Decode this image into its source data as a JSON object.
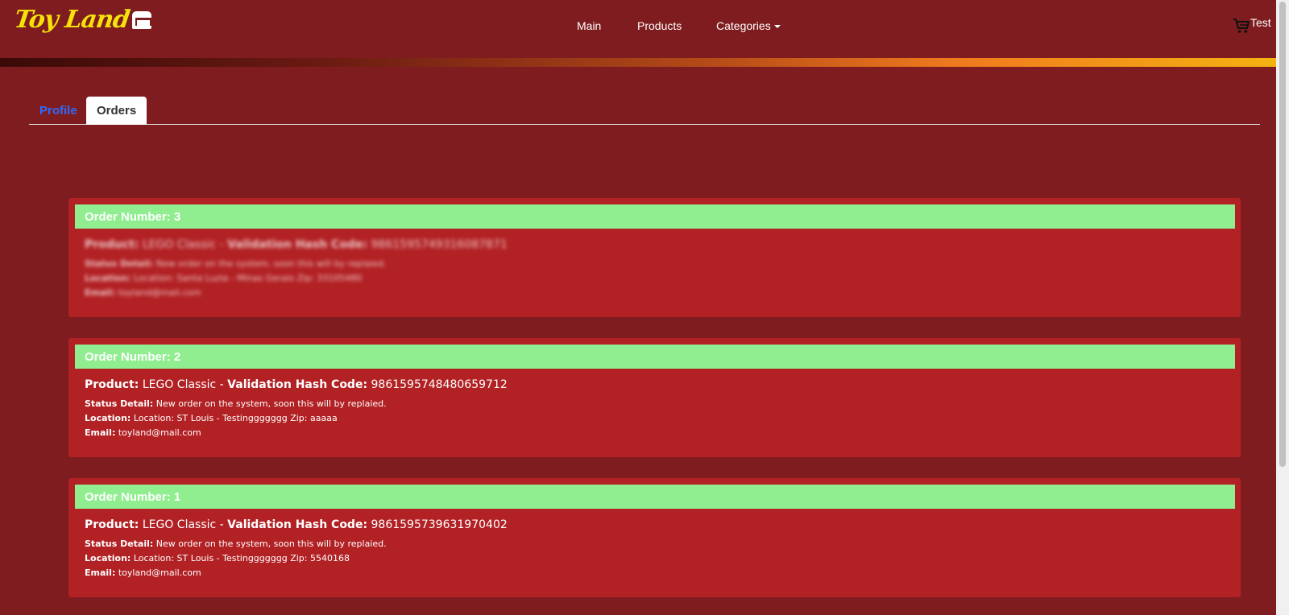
{
  "brand": {
    "logo_text": "Toy Land",
    "logo_icon": "mascot-icon"
  },
  "nav": {
    "main": "Main",
    "products": "Products",
    "categories": "Categories",
    "cart_user": "Test"
  },
  "tabs": {
    "profile": "Profile",
    "orders": "Orders",
    "active": "Orders"
  },
  "labels": {
    "order_number": "Order Number:",
    "product": "Product:",
    "hash": "Validation Hash Code:",
    "status": "Status Detail:",
    "location": "Location:",
    "email": "Email:"
  },
  "orders": [
    {
      "number": "3",
      "product": "LEGO Classic",
      "hash": "9861595749316087871",
      "status": "New order on the system, soon this will by replaied.",
      "location": "Location: Santa Luzia - Minas Gerais Zip: 33105480",
      "email": "toyland@mail.com",
      "blurred": true
    },
    {
      "number": "2",
      "product": "LEGO Classic",
      "hash": "9861595748480659712",
      "status": "New order on the system, soon this will by replaied.",
      "location": "Location: ST Louis - Testinggggggg Zip: aaaaa",
      "email": "toyland@mail.com",
      "blurred": false
    },
    {
      "number": "1",
      "product": "LEGO Classic",
      "hash": "9861595739631970402",
      "status": "New order on the system, soon this will by replaied.",
      "location": "Location: ST Louis - Testinggggggg Zip: 5540168",
      "email": "toyland@mail.com",
      "blurred": false
    }
  ],
  "colors": {
    "background": "#7f1c1f",
    "card": "#b22124",
    "card_header": "#90ee90",
    "logo": "#f5e20a",
    "active_link": "#2f6bff"
  }
}
